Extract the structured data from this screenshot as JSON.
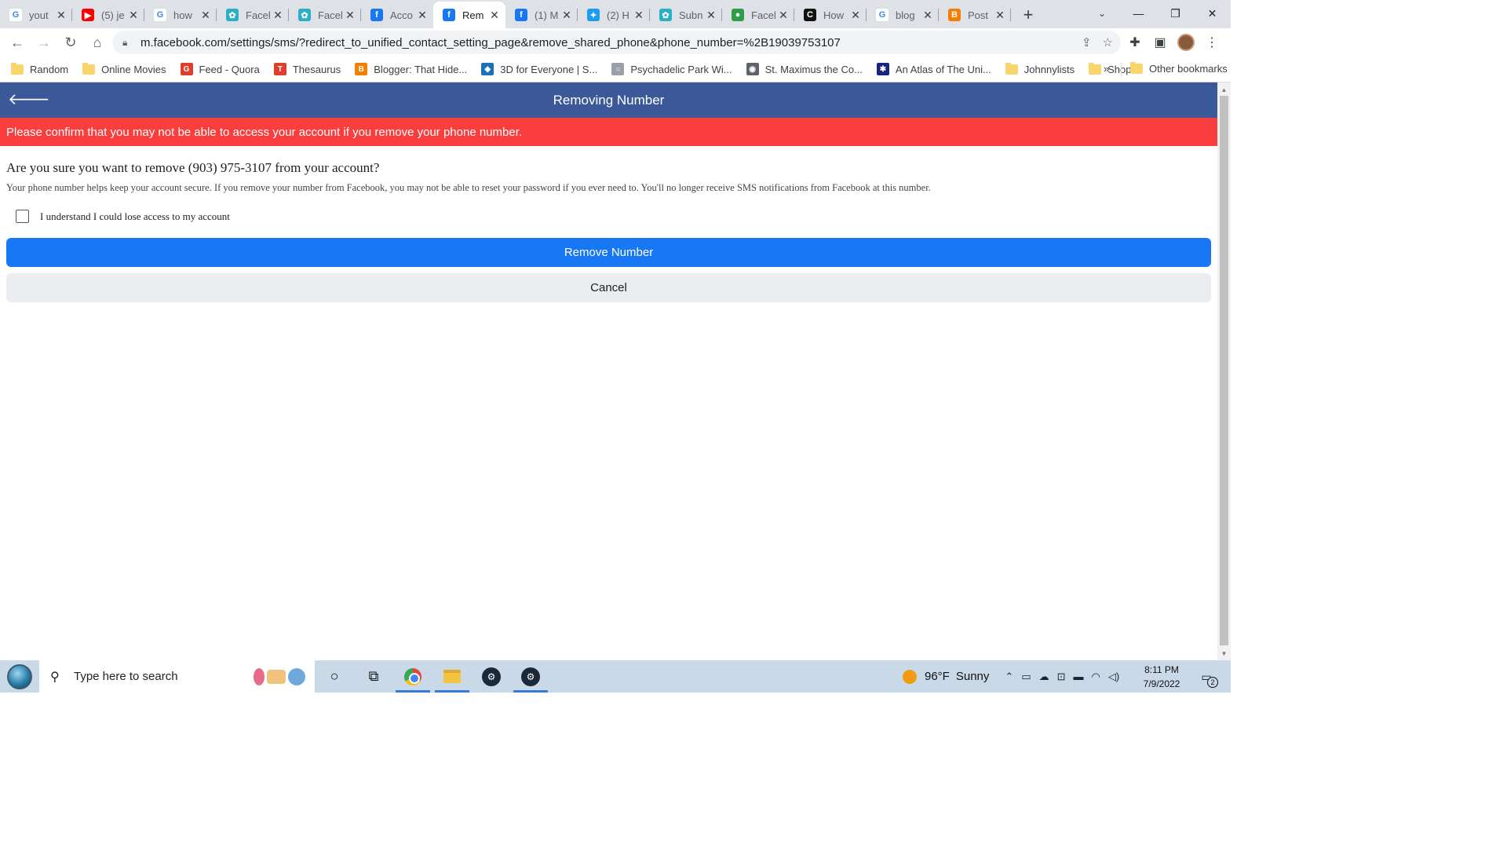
{
  "browser": {
    "tabs": [
      {
        "title": "yout",
        "icon": "google-icon",
        "color": "#ffffff",
        "glyph": "G"
      },
      {
        "title": "(5) je",
        "icon": "youtube-icon",
        "color": "#ff0000",
        "glyph": "▶"
      },
      {
        "title": "how",
        "icon": "google-icon",
        "color": "#ffffff",
        "glyph": "G"
      },
      {
        "title": "Facel",
        "icon": "site-icon",
        "color": "#2ab0c5",
        "glyph": "✿"
      },
      {
        "title": "Facel",
        "icon": "site-icon",
        "color": "#2ab0c5",
        "glyph": "✿"
      },
      {
        "title": "Acco",
        "icon": "facebook-icon",
        "color": "#1877f2",
        "glyph": "f"
      },
      {
        "title": "Rem",
        "icon": "facebook-icon",
        "color": "#1877f2",
        "glyph": "f",
        "active": true
      },
      {
        "title": "(1) M",
        "icon": "facebook-icon",
        "color": "#1877f2",
        "glyph": "f"
      },
      {
        "title": "(2) H",
        "icon": "twitter-icon",
        "color": "#1d9bf0",
        "glyph": "✦"
      },
      {
        "title": "Subn",
        "icon": "site-icon",
        "color": "#2ab0c5",
        "glyph": "✿"
      },
      {
        "title": "Facel",
        "icon": "site-icon",
        "color": "#2e9c4a",
        "glyph": "●"
      },
      {
        "title": "How",
        "icon": "c-icon",
        "color": "#111111",
        "glyph": "C"
      },
      {
        "title": "blog",
        "icon": "google-icon",
        "color": "#ffffff",
        "glyph": "G"
      },
      {
        "title": "Post",
        "icon": "blogger-icon",
        "color": "#f57d00",
        "glyph": "B"
      }
    ],
    "url": "m.facebook.com/settings/sms/?redirect_to_unified_contact_setting_page&remove_shared_phone&phone_number=%2B19039753107",
    "bookmarks": [
      {
        "label": "Random",
        "type": "folder"
      },
      {
        "label": "Online Movies",
        "type": "folder"
      },
      {
        "label": "Feed - Quora",
        "type": "site",
        "color": "#e03e2d",
        "glyph": "G"
      },
      {
        "label": "Thesaurus",
        "type": "site",
        "color": "#e03e2d",
        "glyph": "T"
      },
      {
        "label": "Blogger: That Hide...",
        "type": "site",
        "color": "#f57d00",
        "glyph": "B"
      },
      {
        "label": "3D for Everyone | S...",
        "type": "site",
        "color": "#1e6fb8",
        "glyph": "◆"
      },
      {
        "label": "Psychadelic Park Wi...",
        "type": "site",
        "color": "#9aa0a6",
        "glyph": "○"
      },
      {
        "label": "St. Maximus the Co...",
        "type": "site",
        "color": "#5f6368",
        "glyph": "◉"
      },
      {
        "label": "An Atlas of The Uni...",
        "type": "site",
        "color": "#1a237e",
        "glyph": "✱"
      },
      {
        "label": "Johnnylists",
        "type": "folder"
      },
      {
        "label": "Shop",
        "type": "folder"
      }
    ],
    "bookmarks_more": "»",
    "other_bookmarks": "Other bookmarks"
  },
  "page": {
    "header_title": "Removing Number",
    "warning": "Please confirm that you may not be able to access your account if you remove your phone number.",
    "question": "Are you sure you want to remove (903) 975-3107 from your account?",
    "explanation": "Your phone number helps keep your account secure. If you remove your number from Facebook, you may not be able to reset your password if you ever need to. You'll no longer receive SMS notifications from Facebook at this number.",
    "checkbox_label": "I understand I could lose access to my account",
    "checkbox_checked": false,
    "primary_button": "Remove Number",
    "secondary_button": "Cancel",
    "colors": {
      "header": "#3b5998",
      "warning": "#fa3e3e",
      "primary": "#1877f2"
    }
  },
  "taskbar": {
    "search_placeholder": "Type here to search",
    "weather_temp": "96°F",
    "weather_text": "Sunny",
    "time": "8:11 PM",
    "date": "7/9/2022",
    "notification_count": "2"
  }
}
